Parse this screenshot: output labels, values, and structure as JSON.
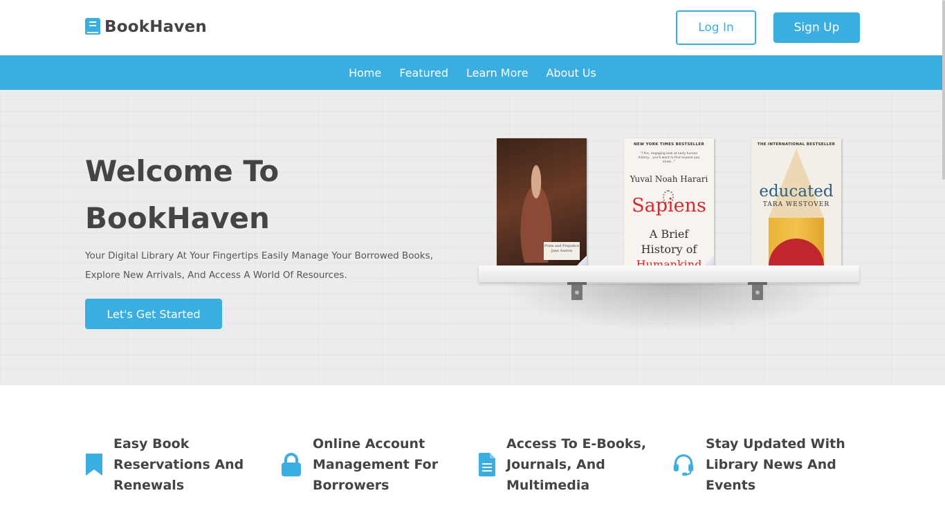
{
  "brand": {
    "name": "BookHaven",
    "icon": "book-icon",
    "color": "#3aaee0"
  },
  "header": {
    "login_label": "Log In",
    "signup_label": "Sign Up"
  },
  "nav": {
    "items": [
      "Home",
      "Featured",
      "Learn More",
      "About Us"
    ]
  },
  "hero": {
    "title_line1": "Welcome To",
    "title_line2": "BookHaven",
    "subtitle_line1": "Your Digital Library At Your Fingertips Easily Manage Your Borrowed Books,",
    "subtitle_line2": "Explore New Arrivals, And Access A World Of Resources.",
    "cta_label": "Let's Get Started"
  },
  "books": [
    {
      "cover_label": "Pride and Prejudice",
      "cover_sub": "Jane Austen"
    },
    {
      "top_text": "NEW YORK TIMES BESTSELLER",
      "quote": "\"I fire, engaging look at early human history... you'll want to find anyone you know...\"",
      "author": "Yuval Noah Harari",
      "title": "Sapiens",
      "sub_line1": "A Brief",
      "sub_line2": "History of",
      "sub_line3": "Humankind"
    },
    {
      "top_text": "THE INTERNATIONAL BESTSELLER",
      "title": "educated",
      "author": "TARA WESTOVER"
    }
  ],
  "features": [
    {
      "icon": "bookmark-icon",
      "line1": "Easy Book",
      "line2": "Reservations And",
      "line3": "Renewals"
    },
    {
      "icon": "lock-icon",
      "line1": "Online Account",
      "line2": "Management For",
      "line3": "Borrowers"
    },
    {
      "icon": "document-icon",
      "line1": "Access To E-Books,",
      "line2": "Journals, And",
      "line3": "Multimedia"
    },
    {
      "icon": "headset-icon",
      "line1": "Stay Updated With",
      "line2": "Library News And",
      "line3": "Events"
    }
  ]
}
